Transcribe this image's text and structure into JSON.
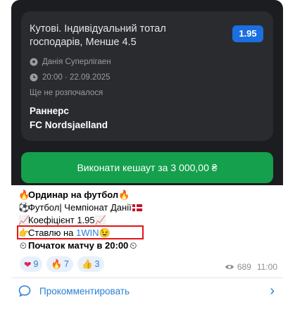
{
  "bet": {
    "title": "Кутові. Індивідуальний тотал господарів, Менше 4.5",
    "odds": "1.95",
    "league": "Данія Суперлігаен",
    "datetime": "20:00 · 22.09.2025",
    "status": "Ще не розпочалося",
    "team_home": "Раннерс",
    "team_away": "FC Nordsjaelland"
  },
  "cashout": {
    "label": "Виконати кешаут за 3 000,00 ₴"
  },
  "message": {
    "line1_emoji_left": "🔥",
    "line1_text": "Ординар на футбол",
    "line1_emoji_right": "🔥",
    "line2_emoji": "⚽",
    "line2_text": "Футбол| Чемпіонат Данії",
    "line3_emoji": "📈",
    "line3_text": "Коефіцієнт 1.95",
    "line4_emoji": "👉",
    "line4_text": "Ставлю на ",
    "line4_link": "1WIN",
    "line4_emoji_right": "😉",
    "line5_emoji": "⏲",
    "line5_text": "Початок матчу в 20:00"
  },
  "reactions": [
    {
      "emoji": "❤",
      "count": "9"
    },
    {
      "emoji": "🔥",
      "count": "7"
    },
    {
      "emoji": "👍",
      "count": "3"
    }
  ],
  "views": "689",
  "time": "11:00",
  "comments": {
    "label": "Прокомментировать"
  },
  "colors": {
    "dark_bg": "#1c1d20",
    "card_bg": "#2a2b2f",
    "odds_badge": "#1b6fe0",
    "cashout_green": "#14a04c",
    "link_blue": "#2a80d6",
    "highlight_red": "#e01616"
  }
}
